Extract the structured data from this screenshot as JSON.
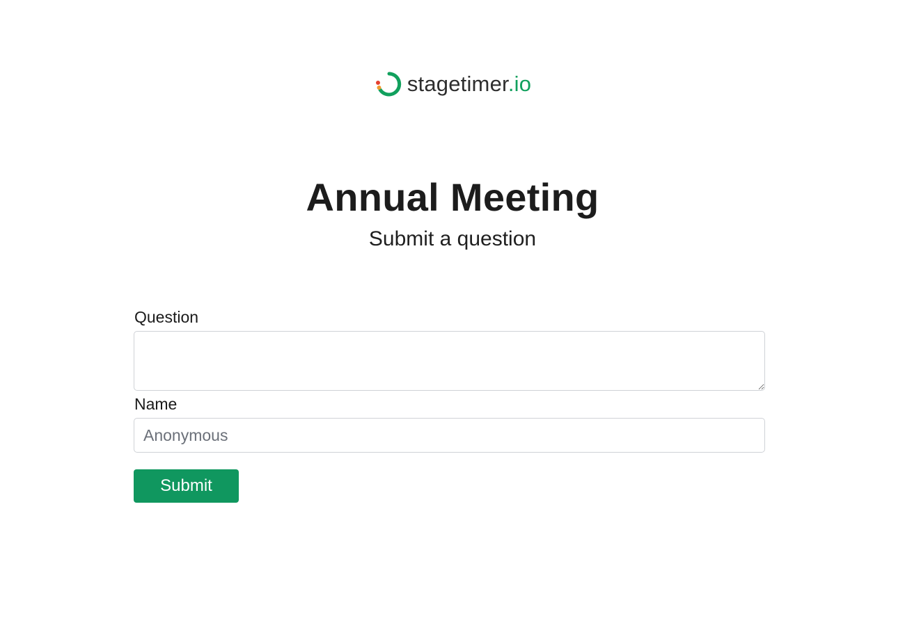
{
  "brand": {
    "name_main": "stagetimer",
    "name_accent": ".io",
    "logo_icon": "stagetimer-logo-icon",
    "colors": {
      "accent": "#11a05d",
      "dot_red": "#e5402f",
      "dot_orange": "#f29a2e"
    }
  },
  "header": {
    "title": "Annual Meeting",
    "subtitle": "Submit a question"
  },
  "form": {
    "question_label": "Question",
    "question_value": "",
    "name_label": "Name",
    "name_value": "",
    "name_placeholder": "Anonymous",
    "submit_label": "Submit",
    "submit_color": "#10975f"
  }
}
